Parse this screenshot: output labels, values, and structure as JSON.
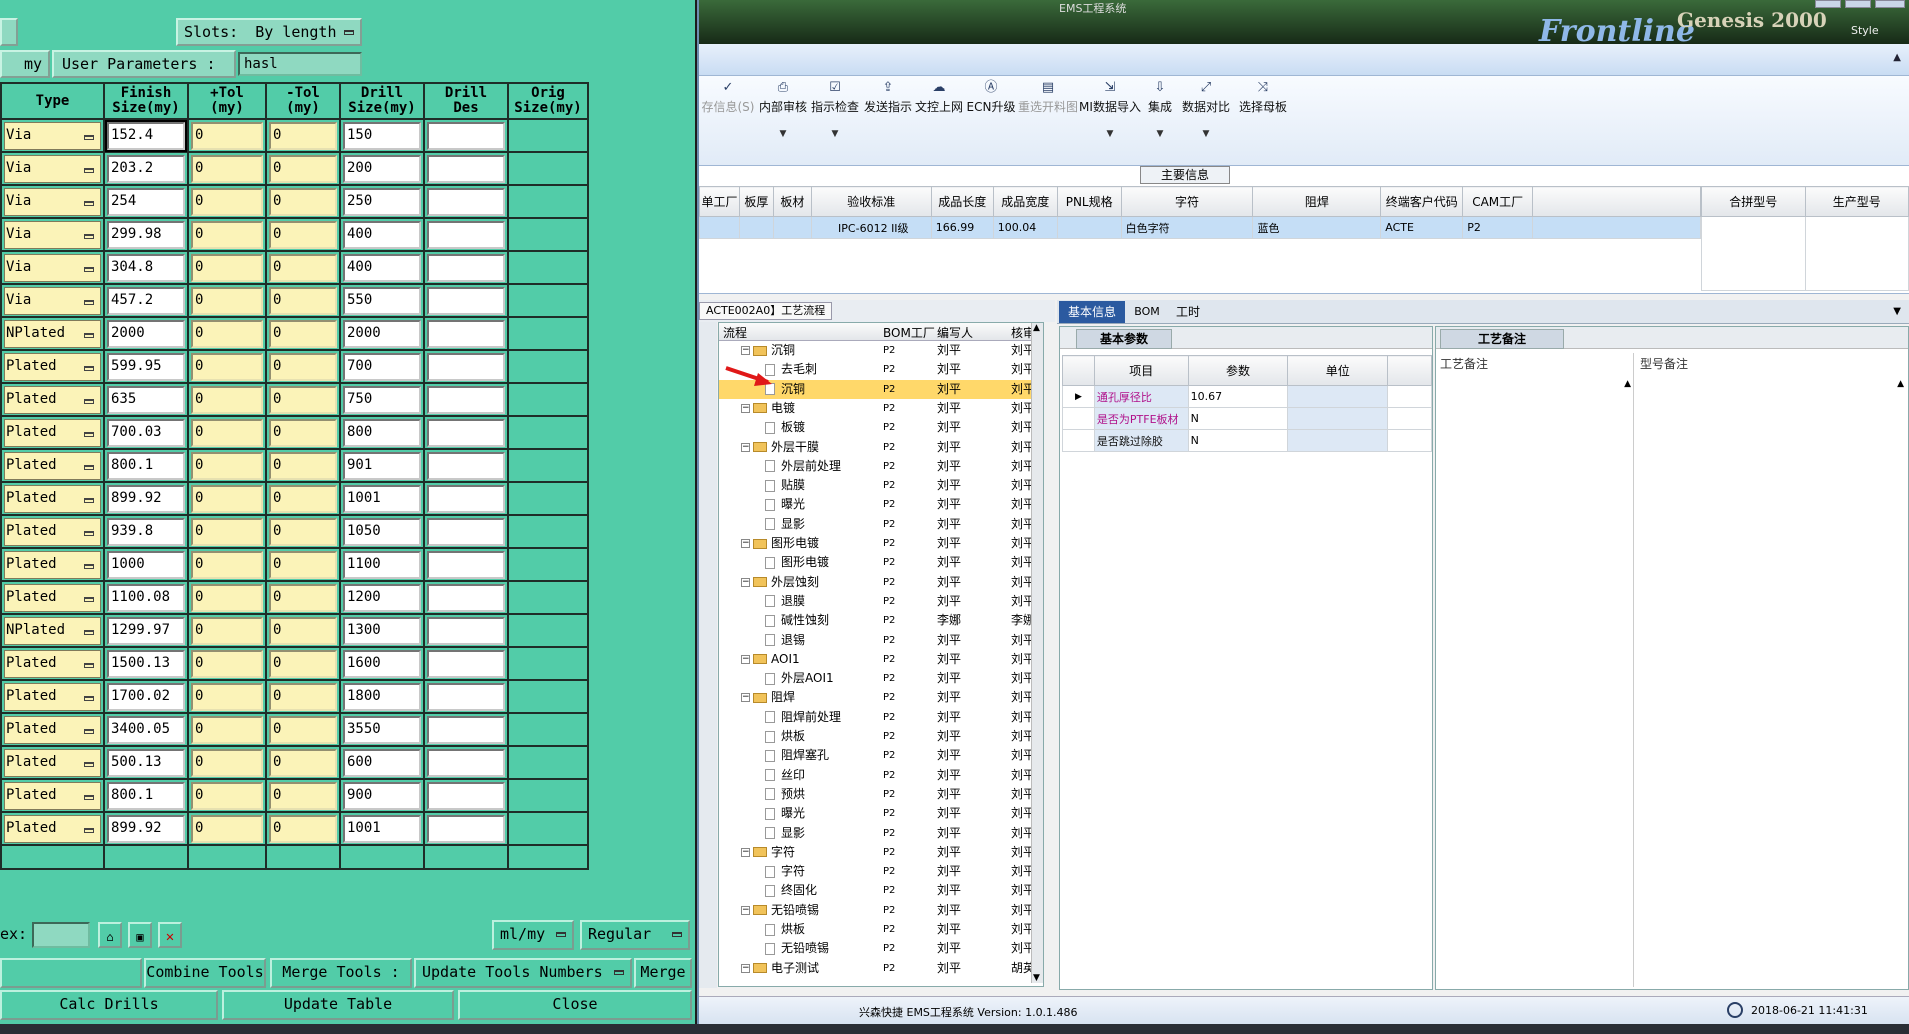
{
  "left": {
    "slots_label": "Slots:",
    "slots_value": "By length",
    "my_label": "my",
    "user_params_label": "User Parameters :",
    "user_params_value": "hasl",
    "headers": [
      "Type",
      "Finish\nSize(my)",
      "+Tol\n(my)",
      "-Tol\n(my)",
      "Drill\nSize(my)",
      "Drill\nDes",
      "Orig\nSize(my)"
    ],
    "rows": [
      {
        "type": "Via",
        "finish": "152.4",
        "ptol": "0",
        "mtol": "0",
        "drill": "150"
      },
      {
        "type": "Via",
        "finish": "203.2",
        "ptol": "0",
        "mtol": "0",
        "drill": "200"
      },
      {
        "type": "Via",
        "finish": "254",
        "ptol": "0",
        "mtol": "0",
        "drill": "250"
      },
      {
        "type": "Via",
        "finish": "299.98",
        "ptol": "0",
        "mtol": "0",
        "drill": "400"
      },
      {
        "type": "Via",
        "finish": "304.8",
        "ptol": "0",
        "mtol": "0",
        "drill": "400"
      },
      {
        "type": "Via",
        "finish": "457.2",
        "ptol": "0",
        "mtol": "0",
        "drill": "550"
      },
      {
        "type": "NPlated",
        "finish": "2000",
        "ptol": "0",
        "mtol": "0",
        "drill": "2000"
      },
      {
        "type": "Plated",
        "finish": "599.95",
        "ptol": "0",
        "mtol": "0",
        "drill": "700"
      },
      {
        "type": "Plated",
        "finish": "635",
        "ptol": "0",
        "mtol": "0",
        "drill": "750"
      },
      {
        "type": "Plated",
        "finish": "700.03",
        "ptol": "0",
        "mtol": "0",
        "drill": "800"
      },
      {
        "type": "Plated",
        "finish": "800.1",
        "ptol": "0",
        "mtol": "0",
        "drill": "901"
      },
      {
        "type": "Plated",
        "finish": "899.92",
        "ptol": "0",
        "mtol": "0",
        "drill": "1001"
      },
      {
        "type": "Plated",
        "finish": "939.8",
        "ptol": "0",
        "mtol": "0",
        "drill": "1050"
      },
      {
        "type": "Plated",
        "finish": "1000",
        "ptol": "0",
        "mtol": "0",
        "drill": "1100"
      },
      {
        "type": "Plated",
        "finish": "1100.08",
        "ptol": "0",
        "mtol": "0",
        "drill": "1200"
      },
      {
        "type": "NPlated",
        "finish": "1299.97",
        "ptol": "0",
        "mtol": "0",
        "drill": "1300"
      },
      {
        "type": "Plated",
        "finish": "1500.13",
        "ptol": "0",
        "mtol": "0",
        "drill": "1600"
      },
      {
        "type": "Plated",
        "finish": "1700.02",
        "ptol": "0",
        "mtol": "0",
        "drill": "1800"
      },
      {
        "type": "Plated",
        "finish": "3400.05",
        "ptol": "0",
        "mtol": "0",
        "drill": "3550"
      },
      {
        "type": "Plated",
        "finish": "500.13",
        "ptol": "0",
        "mtol": "0",
        "drill": "600"
      },
      {
        "type": "Plated",
        "finish": "800.1",
        "ptol": "0",
        "mtol": "0",
        "drill": "900"
      },
      {
        "type": "Plated",
        "finish": "899.92",
        "ptol": "0",
        "mtol": "0",
        "drill": "1001"
      }
    ],
    "ex_label": "ex:",
    "unit_value": "ml/my",
    "regular_value": "Regular",
    "combine_tools": "Combine Tools",
    "merge_tools_label": "Merge Tools :",
    "update_tools_numbers": "Update Tools Numbers",
    "merge": "Merge",
    "calc_drills": "Calc Drills",
    "update_table": "Update Table",
    "close": "Close"
  },
  "right": {
    "title_text": "EMS工程系统",
    "brand": "Frontline",
    "brand2": "Genesis 2000",
    "style_label": "Style",
    "toolbar": [
      {
        "icon": "check-icon",
        "label": "存信息(S)",
        "dd": false
      },
      {
        "icon": "printer-icon",
        "label": "内部审核",
        "dd": true
      },
      {
        "icon": "checkbox-icon",
        "label": "指示检查",
        "dd": true
      },
      {
        "icon": "upload-icon",
        "label": "发送指示",
        "dd": false
      },
      {
        "icon": "cloud-upload-icon",
        "label": "文控上网",
        "dd": false
      },
      {
        "icon": "ecn-icon",
        "label": "ECN升级",
        "dd": false
      },
      {
        "icon": "image-icon",
        "label": "重选开料图",
        "dd": false
      },
      {
        "icon": "import-icon",
        "label": "MI数据导入",
        "dd": true
      },
      {
        "icon": "download-icon",
        "label": "集成",
        "dd": true
      },
      {
        "icon": "compare-icon",
        "label": "数据对比",
        "dd": true
      },
      {
        "icon": "shuffle-icon",
        "label": "选择母板",
        "dd": false
      }
    ],
    "main_info_title": "主要信息",
    "main_cols": [
      "单工厂",
      "板厚",
      "板材",
      "验收标准",
      "成品长度",
      "成品宽度",
      "PNL规格",
      "字符",
      "阻焊",
      "终端客户代码",
      "CAM工厂"
    ],
    "main_row": [
      "",
      "",
      "",
      "IPC-6012 II级",
      "166.99",
      "100.04",
      "",
      "白色字符",
      "蓝色",
      "ACTE",
      "P2"
    ],
    "side_cols": [
      "合拼型号",
      "生产型号"
    ],
    "flow_tab": "ACTE002A0】工艺流程",
    "tree_cols": [
      "流程",
      "BOM工厂",
      "编写人",
      "核审"
    ],
    "tree": [
      {
        "lvl": 0,
        "name": "沉铜",
        "folder": true,
        "f": "P2",
        "w": "刘平",
        "r": "刘平"
      },
      {
        "lvl": 1,
        "name": "去毛刺",
        "folder": false,
        "f": "P2",
        "w": "刘平",
        "r": "刘平"
      },
      {
        "lvl": 1,
        "name": "沉铜",
        "folder": false,
        "f": "P2",
        "w": "刘平",
        "r": "刘平",
        "hl": true
      },
      {
        "lvl": 0,
        "name": "电镀",
        "folder": true,
        "f": "P2",
        "w": "刘平",
        "r": "刘平"
      },
      {
        "lvl": 1,
        "name": "板镀",
        "folder": false,
        "f": "P2",
        "w": "刘平",
        "r": "刘平"
      },
      {
        "lvl": 0,
        "name": "外层干膜",
        "folder": true,
        "f": "P2",
        "w": "刘平",
        "r": "刘平"
      },
      {
        "lvl": 1,
        "name": "外层前处理",
        "folder": false,
        "f": "P2",
        "w": "刘平",
        "r": "刘平"
      },
      {
        "lvl": 1,
        "name": "贴膜",
        "folder": false,
        "f": "P2",
        "w": "刘平",
        "r": "刘平"
      },
      {
        "lvl": 1,
        "name": "曝光",
        "folder": false,
        "f": "P2",
        "w": "刘平",
        "r": "刘平"
      },
      {
        "lvl": 1,
        "name": "显影",
        "folder": false,
        "f": "P2",
        "w": "刘平",
        "r": "刘平"
      },
      {
        "lvl": 0,
        "name": "图形电镀",
        "folder": true,
        "f": "P2",
        "w": "刘平",
        "r": "刘平"
      },
      {
        "lvl": 1,
        "name": "图形电镀",
        "folder": false,
        "f": "P2",
        "w": "刘平",
        "r": "刘平"
      },
      {
        "lvl": 0,
        "name": "外层蚀刻",
        "folder": true,
        "f": "P2",
        "w": "刘平",
        "r": "刘平"
      },
      {
        "lvl": 1,
        "name": "退膜",
        "folder": false,
        "f": "P2",
        "w": "刘平",
        "r": "刘平"
      },
      {
        "lvl": 1,
        "name": "碱性蚀刻",
        "folder": false,
        "f": "P2",
        "w": "李娜",
        "r": "李娜"
      },
      {
        "lvl": 1,
        "name": "退锡",
        "folder": false,
        "f": "P2",
        "w": "刘平",
        "r": "刘平"
      },
      {
        "lvl": 0,
        "name": "AOI1",
        "folder": true,
        "f": "P2",
        "w": "刘平",
        "r": "刘平"
      },
      {
        "lvl": 1,
        "name": "外层AOI1",
        "folder": false,
        "f": "P2",
        "w": "刘平",
        "r": "刘平"
      },
      {
        "lvl": 0,
        "name": "阻焊",
        "folder": true,
        "f": "P2",
        "w": "刘平",
        "r": "刘平"
      },
      {
        "lvl": 1,
        "name": "阻焊前处理",
        "folder": false,
        "f": "P2",
        "w": "刘平",
        "r": "刘平"
      },
      {
        "lvl": 1,
        "name": "烘板",
        "folder": false,
        "f": "P2",
        "w": "刘平",
        "r": "刘平"
      },
      {
        "lvl": 1,
        "name": "阻焊塞孔",
        "folder": false,
        "f": "P2",
        "w": "刘平",
        "r": "刘平"
      },
      {
        "lvl": 1,
        "name": "丝印",
        "folder": false,
        "f": "P2",
        "w": "刘平",
        "r": "刘平"
      },
      {
        "lvl": 1,
        "name": "预烘",
        "folder": false,
        "f": "P2",
        "w": "刘平",
        "r": "刘平"
      },
      {
        "lvl": 1,
        "name": "曝光",
        "folder": false,
        "f": "P2",
        "w": "刘平",
        "r": "刘平"
      },
      {
        "lvl": 1,
        "name": "显影",
        "folder": false,
        "f": "P2",
        "w": "刘平",
        "r": "刘平"
      },
      {
        "lvl": 0,
        "name": "字符",
        "folder": true,
        "f": "P2",
        "w": "刘平",
        "r": "刘平"
      },
      {
        "lvl": 1,
        "name": "字符",
        "folder": false,
        "f": "P2",
        "w": "刘平",
        "r": "刘平"
      },
      {
        "lvl": 1,
        "name": "终固化",
        "folder": false,
        "f": "P2",
        "w": "刘平",
        "r": "刘平"
      },
      {
        "lvl": 0,
        "name": "无铅喷锡",
        "folder": true,
        "f": "P2",
        "w": "刘平",
        "r": "刘平"
      },
      {
        "lvl": 1,
        "name": "烘板",
        "folder": false,
        "f": "P2",
        "w": "刘平",
        "r": "刘平"
      },
      {
        "lvl": 1,
        "name": "无铅喷锡",
        "folder": false,
        "f": "P2",
        "w": "刘平",
        "r": "刘平"
      },
      {
        "lvl": 0,
        "name": "电子测试",
        "folder": true,
        "f": "P2",
        "w": "刘平",
        "r": "胡英"
      }
    ],
    "tab_basic": "基本信息",
    "tab_bom": "BOM",
    "tab_time": "工时",
    "basic_params": "基本参数",
    "param_cols": [
      "项目",
      "参数",
      "单位"
    ],
    "params": [
      {
        "item": "通孔厚径比",
        "val": "10.67",
        "unit": ""
      },
      {
        "item": "是否为PTFE板材",
        "val": "N",
        "unit": ""
      },
      {
        "item": "是否跳过除胶",
        "val": "N",
        "unit": ""
      }
    ],
    "process_notes_tab": "工艺备注",
    "process_notes_col": "工艺备注",
    "model_notes_col": "型号备注",
    "status_app": "兴森快捷 EMS工程系统 Version: 1.0.1.486",
    "status_time": "2018-06-21 11:41:31"
  }
}
